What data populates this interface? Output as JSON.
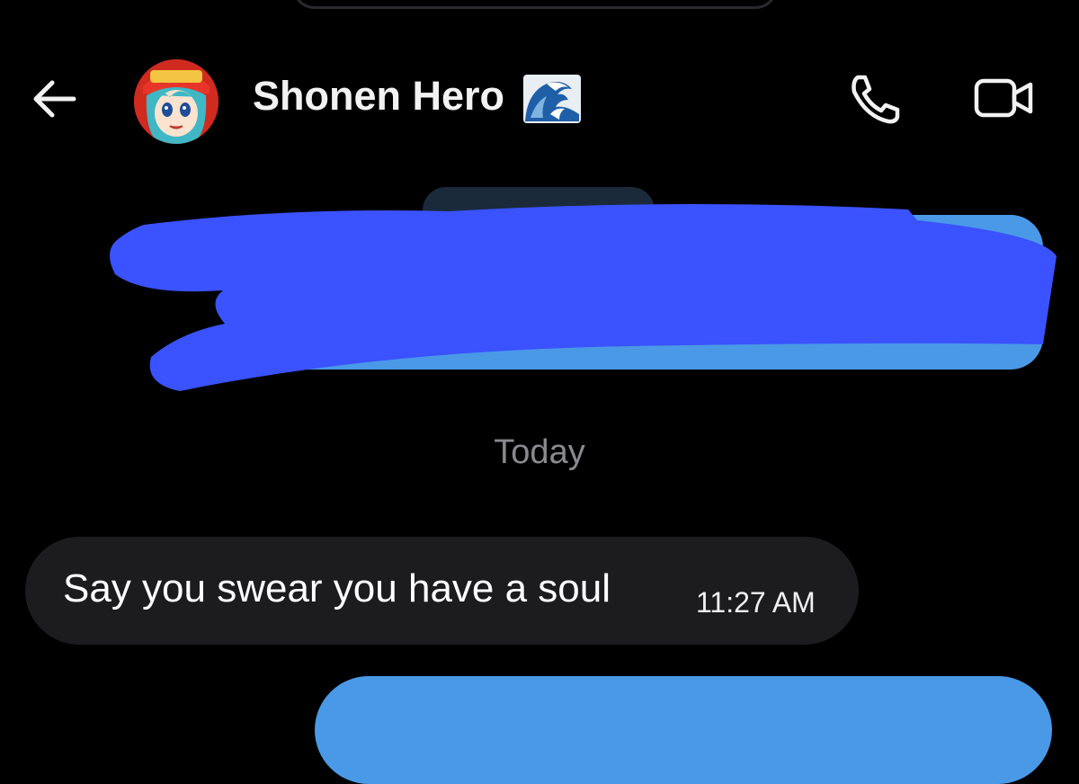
{
  "header": {
    "back_icon": "arrow-left-icon",
    "contact_name": "Shonen Hero",
    "name_emoji": "water-wave-icon",
    "call_icon": "phone-icon",
    "video_icon": "video-camera-icon"
  },
  "conversation": {
    "date_separator": "Today",
    "messages": [
      {
        "direction": "incoming",
        "text": "Say you swear you have a soul",
        "time": "11:27 AM"
      }
    ]
  },
  "colors": {
    "background": "#000000",
    "incoming_bubble": "#1c1c1f",
    "outgoing_bubble": "#4a99e6",
    "redaction_scribble": "#3a52ff",
    "secondary_text": "#8a8a8e"
  }
}
